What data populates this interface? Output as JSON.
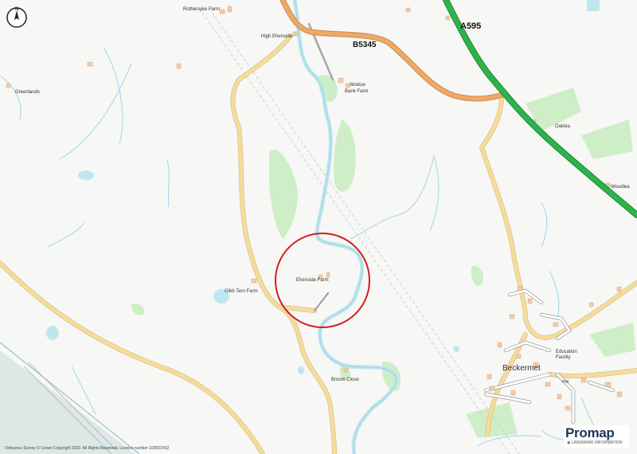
{
  "map": {
    "roads": {
      "a_road": "A595",
      "b_road": "B5345"
    },
    "places": {
      "rothersyke_farm": "Rothersyke Farm",
      "high_ehenside": "High Ehenside",
      "greenlands": "Greenlands",
      "wodow_bank_farm_line1": "Wodow",
      "wodow_bank_farm_line2": "Bank Farm",
      "oaklea": "Oaklea",
      "woodlea": "Woodlea",
      "ehenside_farm": "Ehenside Farm",
      "gibb_tarn_farm": "Gibb Tarn Farm",
      "broom_close": "Broom Close",
      "beckermet": "Beckermet",
      "education_facility_line1": "Education",
      "education_facility_line2": "Facility",
      "pw": "PW"
    },
    "compass_letter": "N",
    "copyright": "Ordnance Survey © Crown Copyright 2022. All Rights Reserved. Licence number 100022432",
    "logo": {
      "brand": "Promap",
      "subtitle": "◉ LANDMARK INFORMATION"
    },
    "colors": {
      "a_road": "#2eb24a",
      "b_road": "#f0a965",
      "minor_road": "#f5dc9a",
      "river": "#bfe6ef",
      "woodland": "#c9ecc2",
      "site_circle": "#d01e1e",
      "railway": "#cfcfcf"
    }
  }
}
